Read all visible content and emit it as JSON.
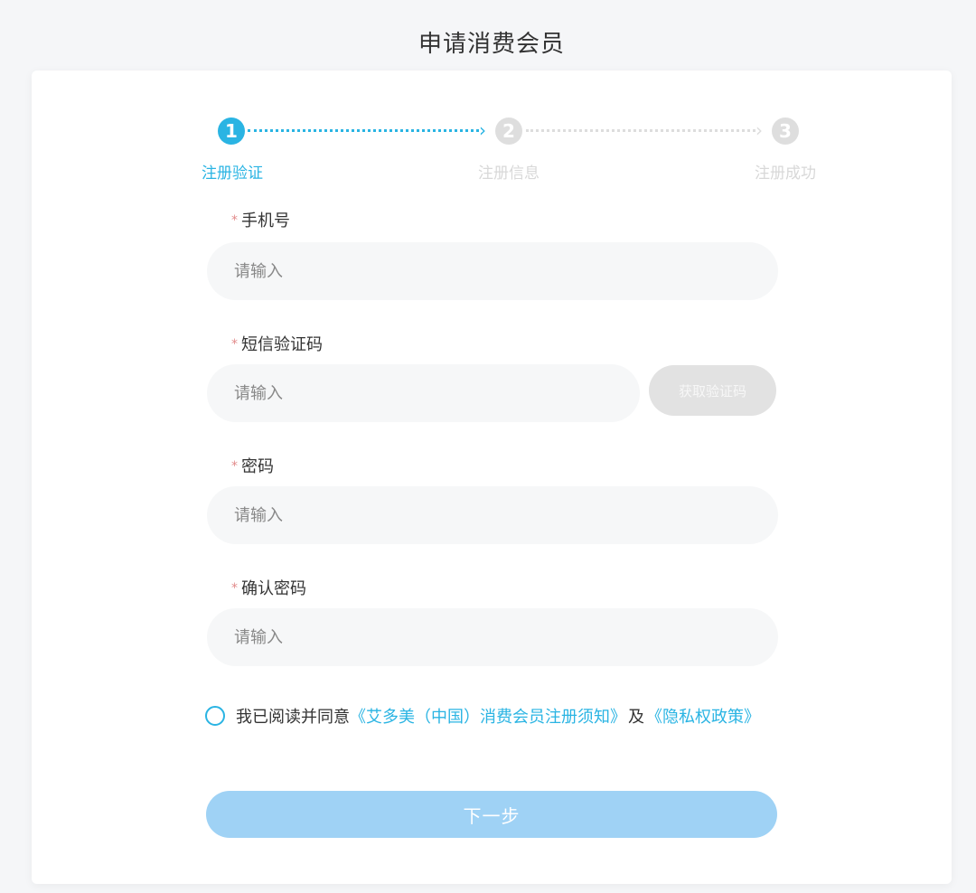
{
  "page": {
    "title": "申请消费会员"
  },
  "steps": [
    {
      "number": "1",
      "label": "注册验证",
      "active": true
    },
    {
      "number": "2",
      "label": "注册信息",
      "active": false
    },
    {
      "number": "3",
      "label": "注册成功",
      "active": false
    }
  ],
  "form": {
    "required_mark": "*",
    "phone": {
      "label": "手机号",
      "placeholder": "请输入",
      "value": ""
    },
    "sms_code": {
      "label": "短信验证码",
      "placeholder": "请输入",
      "value": "",
      "button": "获取验证码"
    },
    "password": {
      "label": "密码",
      "placeholder": "请输入",
      "value": ""
    },
    "confirm_password": {
      "label": "确认密码",
      "placeholder": "请输入",
      "value": ""
    },
    "agreement": {
      "prefix": "我已阅读并同意",
      "link1": "《艾多美（中国）消费会员注册须知》",
      "middle": "及",
      "link2": "《隐私权政策》",
      "checked": false
    },
    "next_button": "下一步"
  },
  "colors": {
    "accent": "#2ab4e3",
    "inactive": "#dedede",
    "next_button_disabled": "#9fd2f5",
    "required": "#e28a8a"
  }
}
